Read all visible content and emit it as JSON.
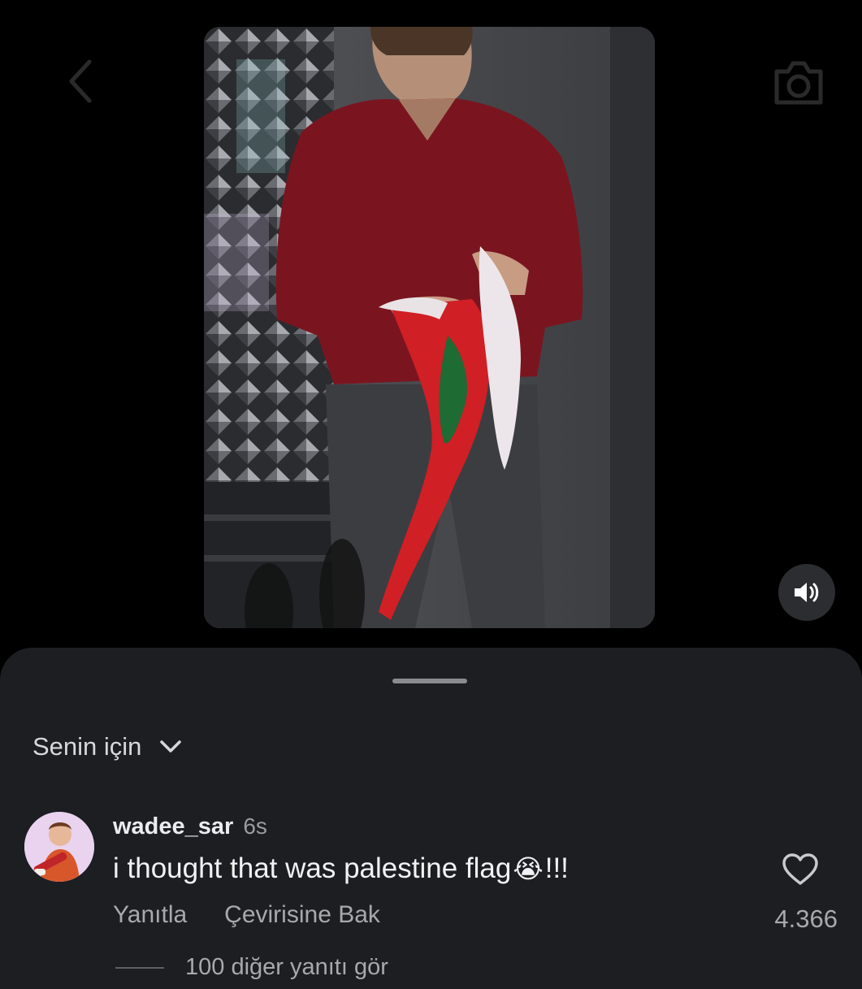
{
  "icons": {
    "back": "chevron-left-icon",
    "camera": "camera-icon",
    "sound": "speaker-icon",
    "sort": "chevron-down-icon",
    "like": "heart-icon",
    "emoji": "loudly-crying-face"
  },
  "colors": {
    "background": "#000000",
    "sheet": "#1c1e22",
    "text_primary": "#f2f2f2",
    "text_secondary": "#a8a9ad",
    "shirt": "#7a1520"
  },
  "comments_sheet": {
    "sort_label": "Senin için",
    "comment": {
      "username": "wadee_sar",
      "timestamp": "6s",
      "text": "i thought that was palestine flag",
      "emoji": "😭",
      "text_suffix": "!!!",
      "reply_label": "Yanıtla",
      "translate_label": "Çevirisine Bak",
      "like_count": "4.366"
    },
    "more_replies_label": "100 diğer yanıtı gör"
  }
}
